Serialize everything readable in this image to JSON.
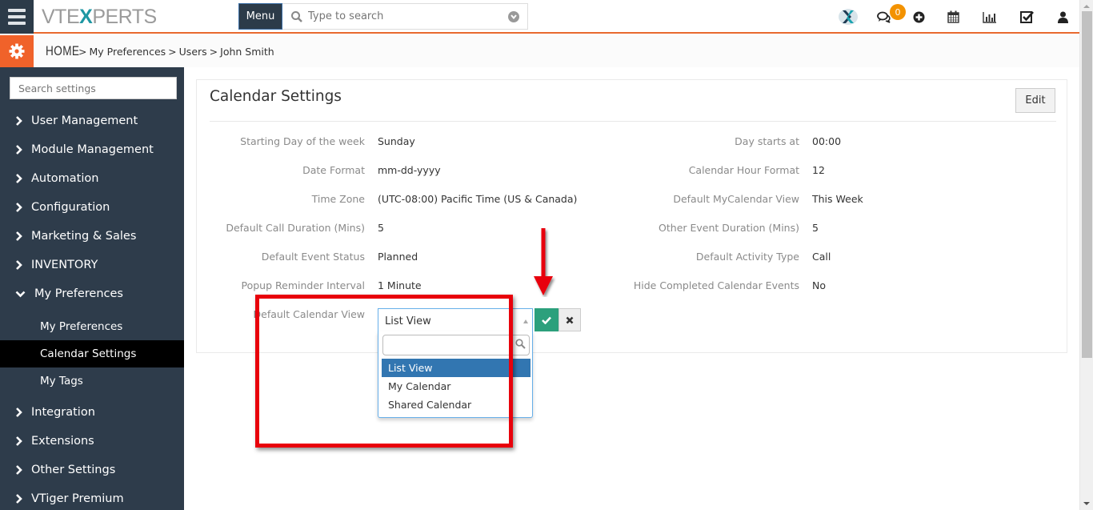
{
  "header": {
    "logo": {
      "pre": "VTE",
      "x": "X",
      "post": "PERTS"
    },
    "menu_label": "Menu",
    "search_placeholder": "Type to search",
    "notification_count": "0",
    "icons": [
      "brand-x-icon",
      "chat-icon",
      "add-circle-icon",
      "calendar-icon",
      "reports-chart-icon",
      "tasks-check-icon",
      "user-icon"
    ],
    "accent_color": "#e8692f"
  },
  "breadcrumb": {
    "home": "HOME",
    "items": [
      "My Preferences",
      "Users",
      "John Smith"
    ]
  },
  "sidebar": {
    "search_placeholder": "Search settings",
    "items": [
      {
        "label": "User Management"
      },
      {
        "label": "Module Management"
      },
      {
        "label": "Automation"
      },
      {
        "label": "Configuration"
      },
      {
        "label": "Marketing & Sales"
      },
      {
        "label": "INVENTORY"
      },
      {
        "label": "My Preferences",
        "expanded": true,
        "children": [
          {
            "label": "My Preferences"
          },
          {
            "label": "Calendar Settings",
            "active": true
          },
          {
            "label": "My Tags"
          }
        ]
      },
      {
        "label": "Integration"
      },
      {
        "label": "Extensions"
      },
      {
        "label": "Other Settings"
      },
      {
        "label": "VTiger Premium"
      }
    ]
  },
  "panel": {
    "title": "Calendar Settings",
    "edit_label": "Edit",
    "left_fields": [
      {
        "label": "Starting Day of the week",
        "value": "Sunday"
      },
      {
        "label": "Date Format",
        "value": "mm-dd-yyyy"
      },
      {
        "label": "Time Zone",
        "value": "(UTC-08:00) Pacific Time (US & Canada)"
      },
      {
        "label": "Default Call Duration (Mins)",
        "value": "5"
      },
      {
        "label": "Default Event Status",
        "value": "Planned"
      },
      {
        "label": "Popup Reminder Interval",
        "value": "1 Minute"
      }
    ],
    "right_fields": [
      {
        "label": "Day starts at",
        "value": "00:00"
      },
      {
        "label": "Calendar Hour Format",
        "value": "12"
      },
      {
        "label": "Default MyCalendar View",
        "value": "This Week"
      },
      {
        "label": "Other Event Duration (Mins)",
        "value": "5"
      },
      {
        "label": "Default Activity Type",
        "value": "Call"
      },
      {
        "label": "Hide Completed Calendar Events",
        "value": "No"
      }
    ],
    "edit_field": {
      "label": "Default Calendar View",
      "selected": "List View",
      "search_value": "",
      "options": [
        "List View",
        "My Calendar",
        "Shared Calendar"
      ],
      "highlighted_option": "List View"
    }
  },
  "annotations": {
    "highlight_color": "#e8000b"
  }
}
